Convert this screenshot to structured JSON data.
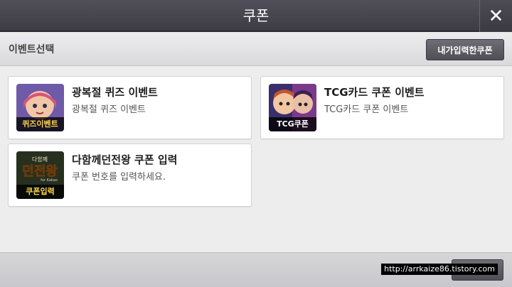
{
  "header": {
    "title": "쿠폰",
    "close_icon": "close-icon"
  },
  "subheader": {
    "label": "이벤트선택",
    "my_coupon_button": "내가입력한쿠폰"
  },
  "cards": [
    {
      "title": "광복절 퀴즈 이벤트",
      "desc": "광복절 퀴즈 이벤트",
      "badge": "퀴즈이벤트"
    },
    {
      "title": "TCG카드 쿠폰 이벤트",
      "desc": "TCG카드 쿠폰 이벤트",
      "badge": "TCG쿠폰"
    },
    {
      "title": "다함께던전왕 쿠폰 입력",
      "desc": "쿠폰 번호를 입력하세요.",
      "badge": "쿠폰입력",
      "logo": "던전왕",
      "logo_small": "다함께",
      "logo_sub": "for Kakao"
    }
  ],
  "watermark": "http://arrkaize86.tistory.com"
}
